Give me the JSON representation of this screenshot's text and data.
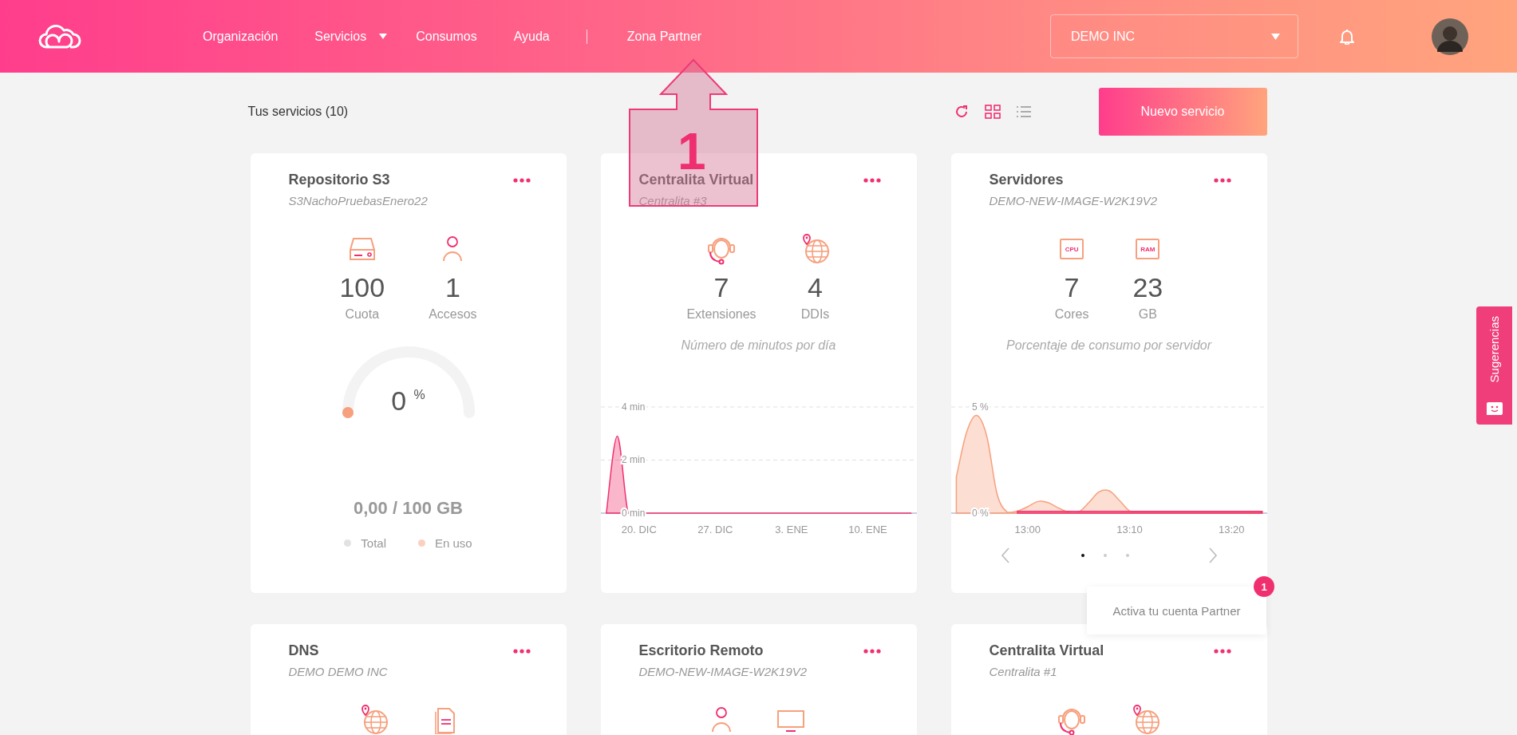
{
  "header": {
    "nav": [
      {
        "label": "Organización",
        "has_menu": false,
        "separator_before": false
      },
      {
        "label": "Servicios",
        "has_menu": true,
        "separator_before": false
      },
      {
        "label": "Consumos",
        "has_menu": false,
        "separator_before": false
      },
      {
        "label": "Ayuda",
        "has_menu": false,
        "separator_before": false
      },
      {
        "label": "Zona Partner",
        "has_menu": false,
        "separator_before": true
      }
    ],
    "org_select": {
      "value": "DEMO INC"
    }
  },
  "toolbar": {
    "title": "Tus servicios (10)",
    "views": [
      {
        "kind": "grid",
        "selected": true
      },
      {
        "kind": "list",
        "selected": false
      }
    ],
    "new_button": "Nuevo servicio"
  },
  "cards": [
    {
      "kind": "storage",
      "title": "Repositorio S3",
      "subtitle": "S3NachoPruebasEnero22",
      "stats": [
        {
          "kind": "disk",
          "value": "100",
          "label": "Cuota"
        },
        {
          "kind": "user",
          "value": "1",
          "label": "Accesos"
        }
      ],
      "gauge": {
        "level": 0,
        "reading": "0 $^{%}$"
      },
      "usage": "0,00 / 100 GB",
      "legend": [
        {
          "label": "Total",
          "color": "#e2e2e2"
        },
        {
          "label": "En uso",
          "color": "#fcd0c0"
        }
      ]
    },
    {
      "kind": "chart",
      "title": "Centralita Virtual",
      "subtitle": "Centralita #3",
      "stats": [
        {
          "kind": "headset",
          "value": "7",
          "label": "Extensiones"
        },
        {
          "kind": "globe",
          "value": "4",
          "label": "DDIs"
        }
      ],
      "caption": "Número de minutos por día",
      "chart_data": {
        "type": "area",
        "categories": [
          null,
          null,
          null,
          "20. DIC",
          null,
          null,
          null,
          null,
          null,
          null,
          "27. DIC",
          null,
          null,
          null,
          null,
          null,
          null,
          "3. ENE",
          null,
          null,
          null,
          null,
          null,
          null,
          "10. ENE",
          null,
          null,
          null,
          null
        ],
        "ylim": [
          0,
          13.56
        ],
        "series": [
          {
            "color": "#f0306e",
            "values": [
              0,
              2.9,
              0,
              0,
              0,
              0,
              0,
              0,
              0,
              0,
              0,
              0,
              0,
              0,
              0,
              0,
              0,
              0,
              0,
              0,
              0,
              0,
              0,
              0,
              0,
              0,
              0,
              0,
              0
            ]
          }
        ],
        "yticks": [
          {
            "value": 0,
            "label": "0 min"
          },
          {
            "value": 2,
            "label": "2 min"
          },
          {
            "value": 4,
            "label": "4 min"
          }
        ]
      }
    },
    {
      "kind": "chart",
      "title": "Servidores",
      "subtitle": "DEMO-NEW-IMAGE-W2K19V2",
      "stats": [
        {
          "kind": "chip",
          "chip_label": "CPU",
          "value": "7",
          "label": "Cores"
        },
        {
          "kind": "chip",
          "chip_label": "RAM",
          "value": "23",
          "label": "GB"
        }
      ],
      "caption": "Porcentaje de consumo por servidor",
      "chart_data": {
        "type": "area",
        "categories": [
          null,
          null,
          null,
          null,
          null,
          null,
          null,
          "13:00",
          null,
          null,
          null,
          null,
          null,
          null,
          null,
          null,
          null,
          "13:10",
          null,
          null,
          null,
          null,
          null,
          null,
          null,
          null,
          null,
          "13:20",
          null,
          null,
          null
        ],
        "ylim": [
          0,
          16.95
        ],
        "series": [
          {
            "color": "#f7a07e",
            "values": [
              1.7,
              3.8,
              4.6,
              3.6,
              0.9,
              0.05,
              0.1,
              0.3,
              0.55,
              0.5,
              0.25,
              0.05,
              0.05,
              0.5,
              1.0,
              1.05,
              0.6,
              0.1,
              0.05,
              0.05,
              0.05,
              0.05,
              0.05,
              0.05,
              0.05,
              0.05,
              0.05,
              0.05,
              0.05,
              0.05,
              0.05
            ]
          },
          {
            "color": "#f0306e",
            "values": [
              null,
              null,
              null,
              null,
              null,
              null,
              0.08,
              0.08,
              0.08,
              0.08,
              0.08,
              0.08,
              0.08,
              0.08,
              0.08,
              0.08,
              0.08,
              0.08,
              0.08,
              0.08,
              0.08,
              0.08,
              0.08,
              0.08,
              0.08,
              0.08,
              0.08,
              0.08,
              0.08,
              0.08,
              0.08
            ]
          }
        ],
        "yticks": [
          {
            "value": 0,
            "label": "0 %"
          },
          {
            "value": 5,
            "label": "5 %"
          }
        ]
      },
      "pager": [
        {
          "selected": true
        },
        {
          "selected": false
        },
        {
          "selected": false
        }
      ]
    },
    {
      "kind": "summary",
      "title": "DNS",
      "subtitle": "DEMO DEMO INC",
      "stats": [
        {
          "kind": "globe"
        },
        {
          "kind": "document"
        }
      ]
    },
    {
      "kind": "summary",
      "title": "Escritorio Remoto",
      "subtitle": "DEMO-NEW-IMAGE-W2K19V2",
      "stats": [
        {
          "kind": "user"
        },
        {
          "kind": "monitor"
        }
      ]
    },
    {
      "kind": "summary",
      "title": "Centralita Virtual",
      "subtitle": "Centralita #1",
      "stats": [
        {
          "kind": "headset"
        },
        {
          "kind": "globe"
        }
      ]
    }
  ],
  "tooltip": {
    "text": "Activa tu cuenta Partner",
    "badge": "1"
  },
  "side_tab": {
    "label": "Sugerencias"
  },
  "callout": {
    "number": "1"
  }
}
